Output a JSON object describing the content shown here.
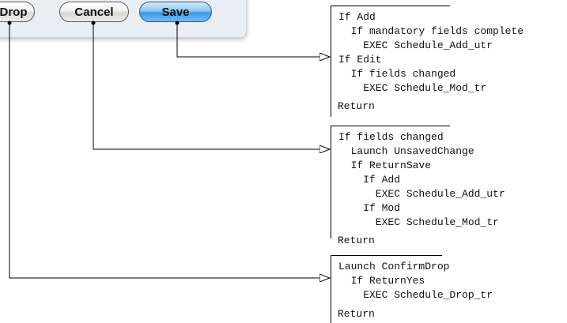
{
  "buttons": {
    "drop": "Drop",
    "cancel": "Cancel",
    "save": "Save"
  },
  "flows": {
    "save": {
      "code": "If Add\n  If mandatory fields complete\n    EXEC Schedule_Add_utr\nIf Edit\n  If fields changed\n    EXEC Schedule_Mod_tr",
      "return": "Return"
    },
    "cancel": {
      "code": "If fields changed\n  Launch UnsavedChange\n  If ReturnSave\n    If Add\n      EXEC Schedule_Add_utr\n    If Mod\n      EXEC Schedule_Mod_tr",
      "return": "Return"
    },
    "drop": {
      "code": "Launch ConfirmDrop\n  If ReturnYes\n    EXEC Schedule_Drop_tr",
      "return": "Return"
    }
  }
}
